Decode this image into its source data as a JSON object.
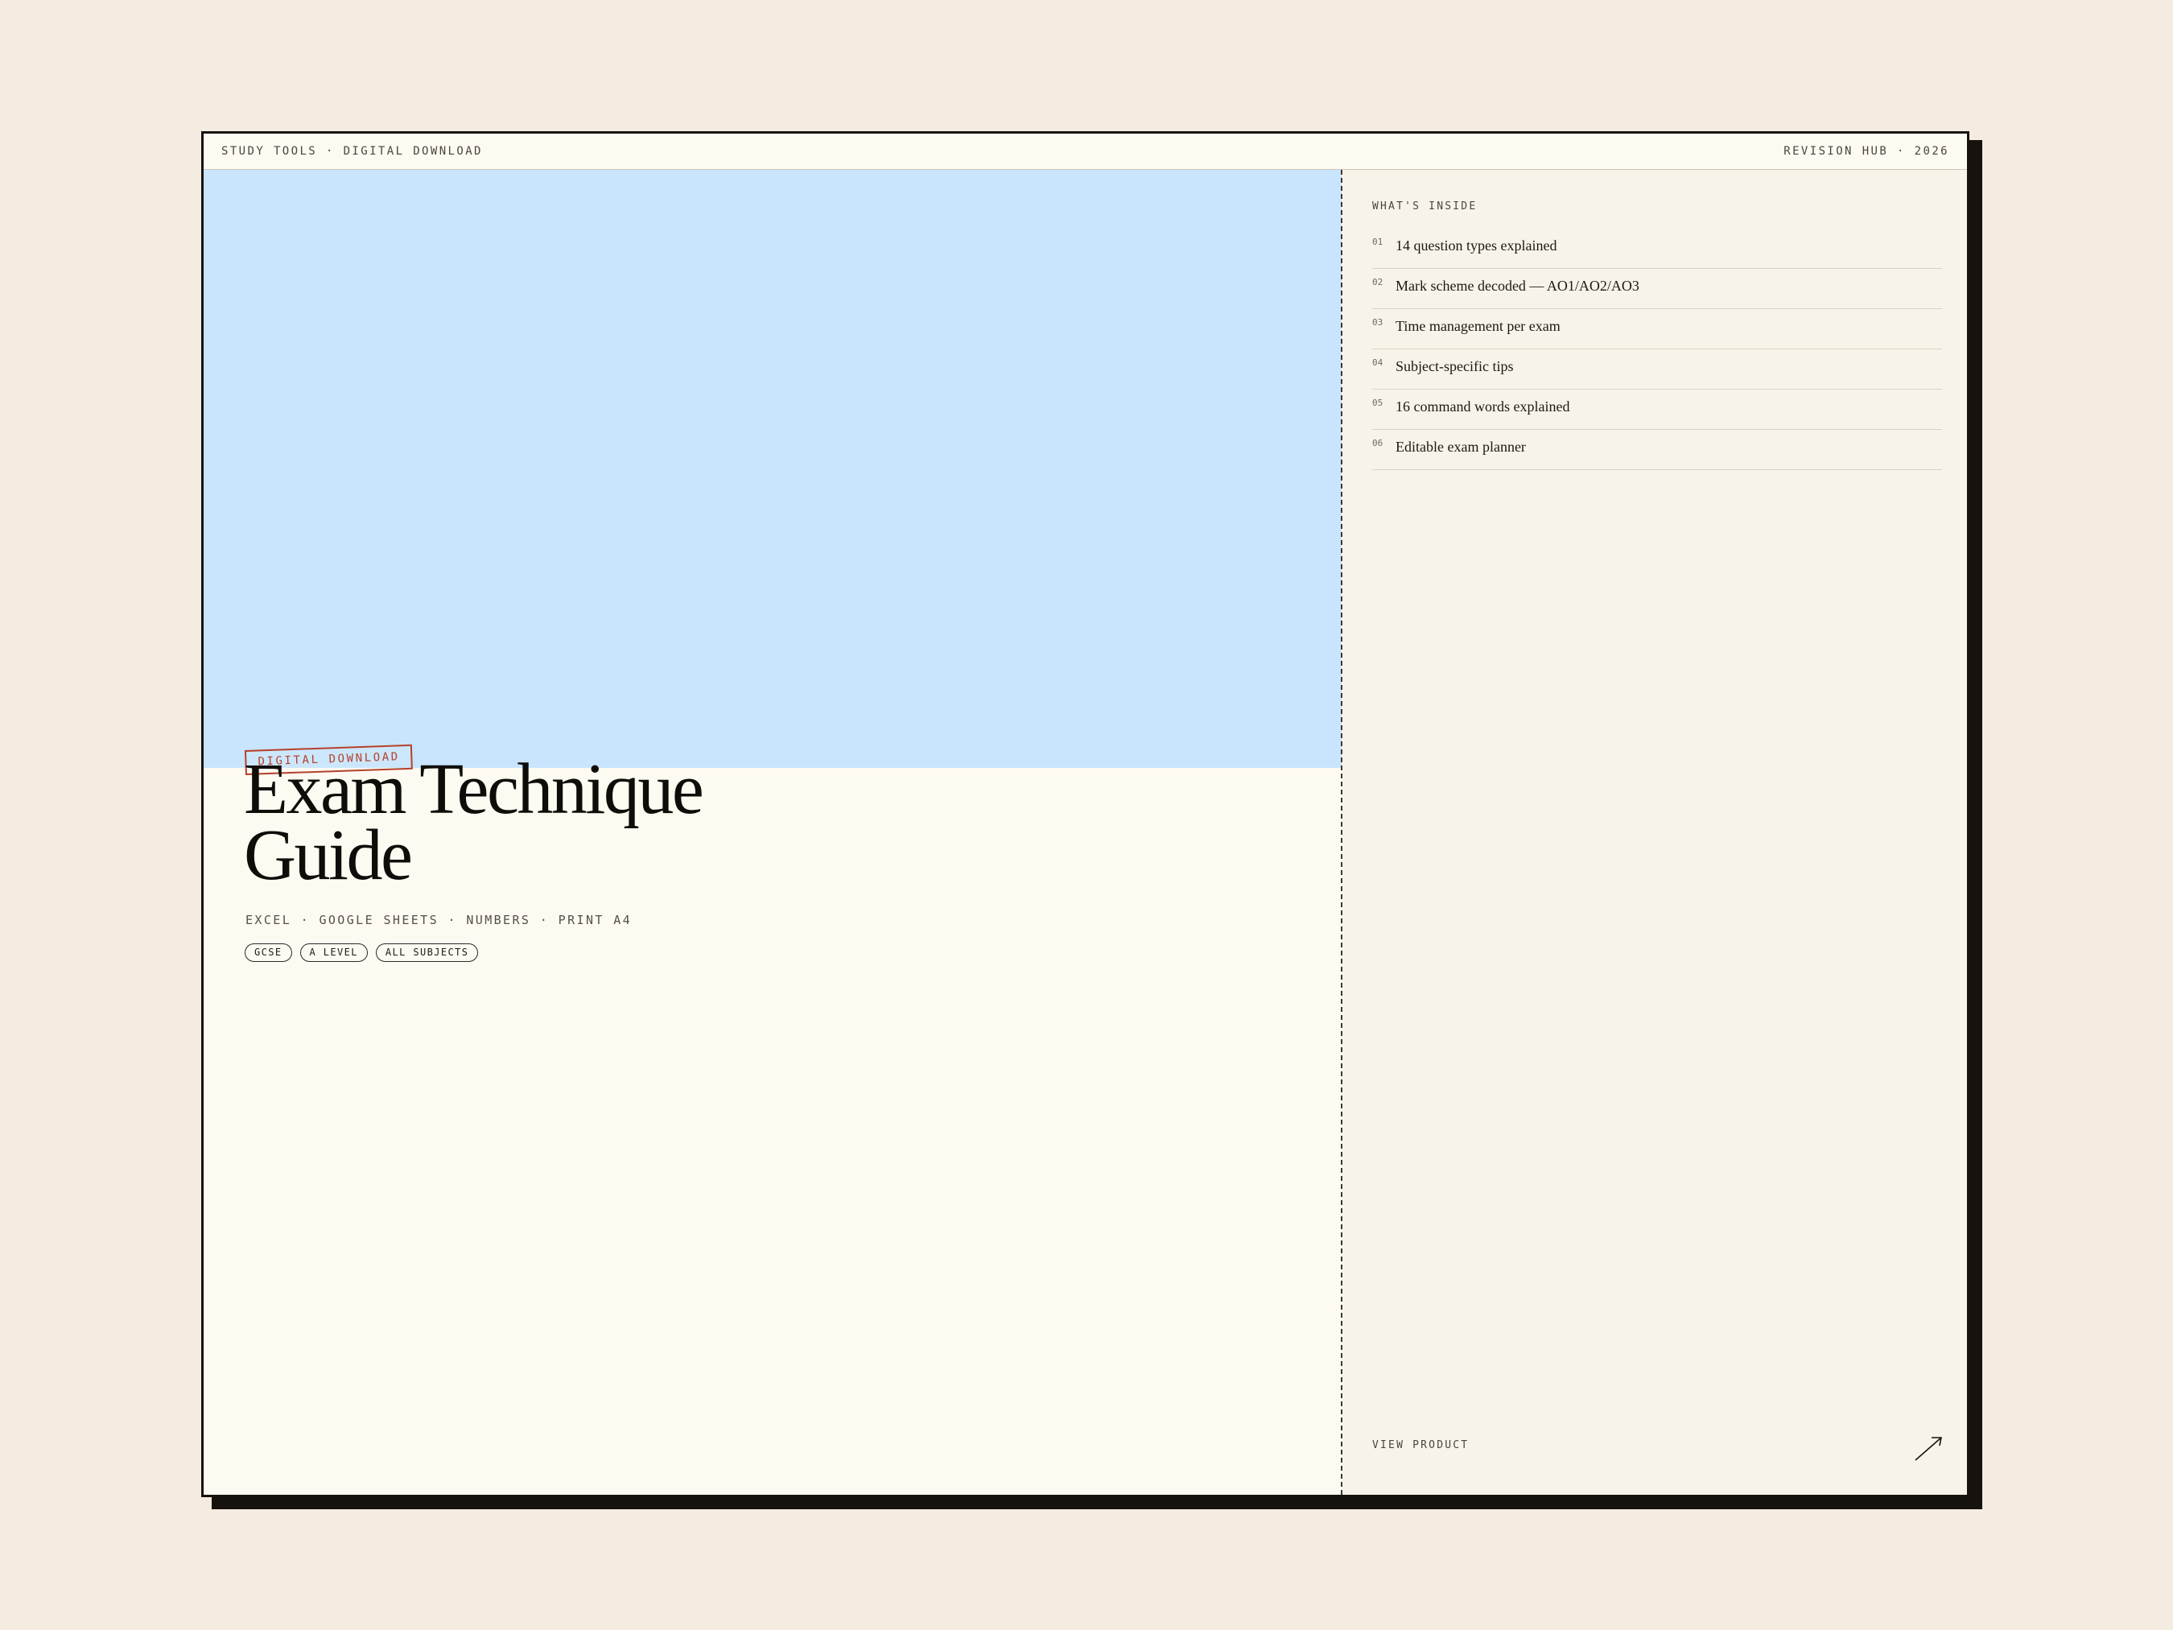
{
  "topbar": {
    "left": "STUDY TOOLS · DIGITAL DOWNLOAD",
    "right": "REVISION HUB · 2026"
  },
  "product": {
    "badge": "DIGITAL DOWNLOAD",
    "title_line1": "Exam Technique",
    "title_line2": "Guide",
    "formats": "EXCEL · GOOGLE SHEETS · NUMBERS · PRINT A4",
    "tags": [
      "GCSE",
      "A LEVEL",
      "ALL SUBJECTS"
    ],
    "hero_color": "#c8e5fd"
  },
  "contents": {
    "heading": "WHAT'S INSIDE",
    "items": [
      {
        "num": "01",
        "text": "14 question types explained"
      },
      {
        "num": "02",
        "text": "Mark scheme decoded — AO1/AO2/AO3"
      },
      {
        "num": "03",
        "text": "Time management per exam"
      },
      {
        "num": "04",
        "text": "Subject-specific tips"
      },
      {
        "num": "05",
        "text": "16 command words explained"
      },
      {
        "num": "06",
        "text": "Editable exam planner"
      }
    ]
  },
  "cta": {
    "label": "VIEW PRODUCT",
    "icon": "arrow-up-right-icon"
  },
  "colors": {
    "background": "#f4ece1",
    "card": "#fdfaf1",
    "stamp": "#b5402b",
    "ink": "#0f0d0a"
  }
}
